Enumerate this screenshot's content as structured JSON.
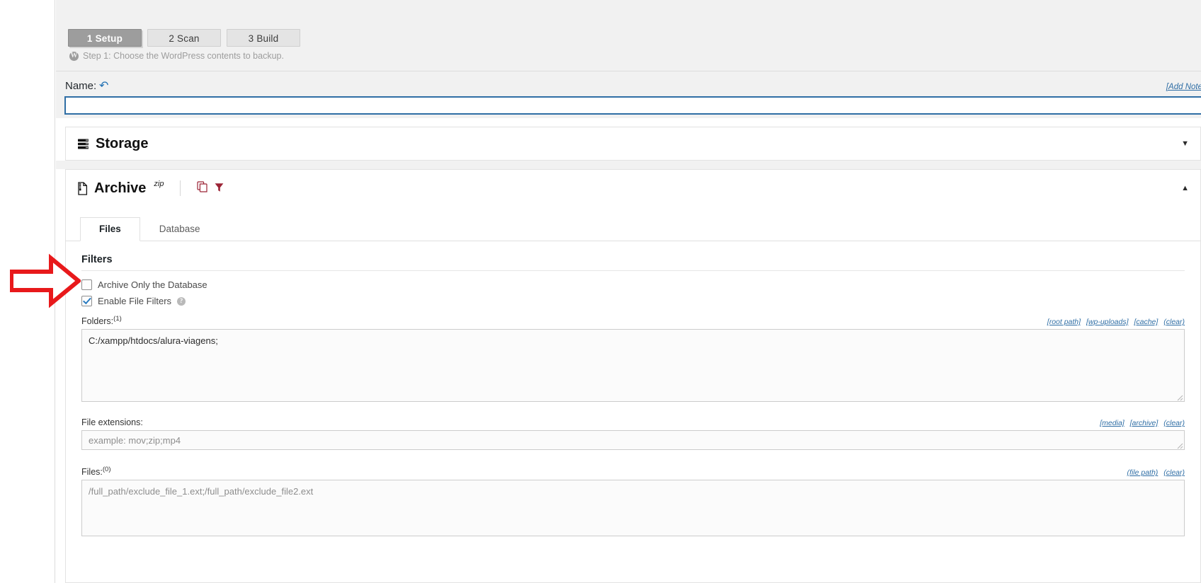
{
  "steps": {
    "items": [
      {
        "label": "1 Setup",
        "active": true
      },
      {
        "label": "2 Scan",
        "active": false
      },
      {
        "label": "3 Build",
        "active": false
      }
    ],
    "description": "Step 1: Choose the WordPress contents to backup.",
    "wp_icon": "wordpress-icon"
  },
  "name_section": {
    "label": "Name:",
    "reset_icon": "reset-arrow-icon",
    "value": "",
    "placeholder": "",
    "add_note_link": "[Add Note"
  },
  "storage_panel": {
    "icon": "server-rack-icon",
    "title": "Storage",
    "toggle_icon": "chevron-down-icon"
  },
  "archive_panel": {
    "icon": "archive-zip-icon",
    "title": "Archive",
    "format": "zip",
    "copy_icon": "copy-icon",
    "filter_icon": "funnel-icon",
    "toggle_icon": "chevron-up-icon",
    "tabs": [
      {
        "label": "Files",
        "active": true
      },
      {
        "label": "Database",
        "active": false
      }
    ],
    "filters": {
      "heading": "Filters",
      "checkboxes": [
        {
          "label": "Archive Only the Database",
          "checked": false,
          "help": false
        },
        {
          "label": "Enable File Filters",
          "checked": true,
          "help": true
        }
      ]
    },
    "folders": {
      "label": "Folders:",
      "count": "(1)",
      "links": [
        "[root path]",
        "[wp-uploads]",
        "[cache]",
        "(clear)"
      ],
      "value": "C:/xampp/htdocs/alura-viagens;",
      "placeholder": ""
    },
    "extensions": {
      "label": "File extensions:",
      "links": [
        "[media]",
        "[archive]",
        "(clear)"
      ],
      "value": "",
      "placeholder": "example: mov;zip;mp4"
    },
    "files": {
      "label": "Files:",
      "count": "(0)",
      "links": [
        "(file path)",
        "(clear)"
      ],
      "value": "",
      "placeholder": "/full_path/exclude_file_1.ext;/full_path/exclude_file2.ext"
    }
  },
  "annotation": {
    "arrow": "red-arrow-pointer"
  },
  "colors": {
    "accent_blue": "#2f6ea5",
    "active_step_bg": "#9d9d9d",
    "annotation_red": "#e8191b",
    "panel_bg": "#f1f1f1"
  }
}
